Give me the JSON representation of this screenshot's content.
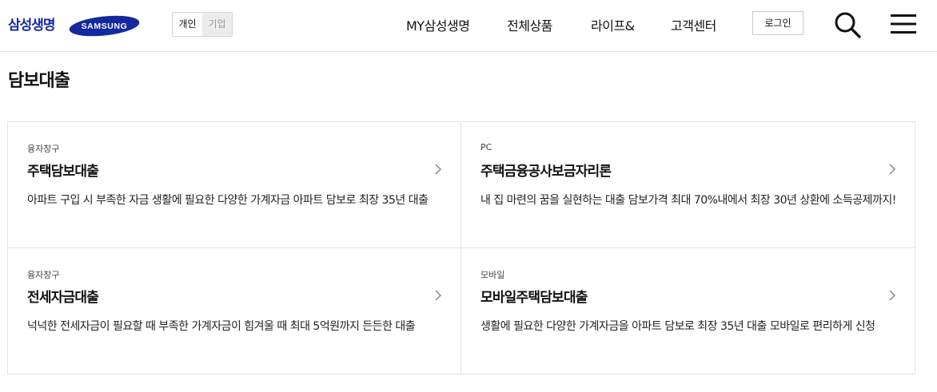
{
  "header": {
    "brand": "삼성생명",
    "logo_text": "SAMSUNG",
    "segment": {
      "personal": "개인",
      "corporate": "기업",
      "selected": "개인"
    },
    "nav": [
      "MY삼성생명",
      "전체상품",
      "라이프&",
      "고객센터"
    ],
    "login_label": "로그인",
    "icons": {
      "search": "search-icon",
      "menu": "hamburger-menu-icon"
    },
    "colors": {
      "brand": "#1428a0"
    }
  },
  "page": {
    "title": "담보대출"
  },
  "cards": [
    {
      "tag": "융자창구",
      "title": "주택담보대출",
      "desc": "아파트 구입 시 부족한 자금 생활에 필요한 다양한 가계자금 아파트 담보로 최장 35년 대출"
    },
    {
      "tag": "PC",
      "title": "주택금융공사보금자리론",
      "desc": "내 집 마련의 꿈을 실현하는 대출 담보가격 최대 70%내에서 최장 30년 상환에 소득공제까지!"
    },
    {
      "tag": "융자창구",
      "title": "전세자금대출",
      "desc": "넉넉한 전세자금이 필요할 때 부족한 가계자금이 힘겨울 때 최대 5억원까지 든든한 대출"
    },
    {
      "tag": "모바일",
      "title": "모바일주택담보대출",
      "desc": "생활에 필요한 다양한 가계자금을 아파트 담보로 최장 35년 대출 모바일로 편리하게 신청"
    }
  ]
}
